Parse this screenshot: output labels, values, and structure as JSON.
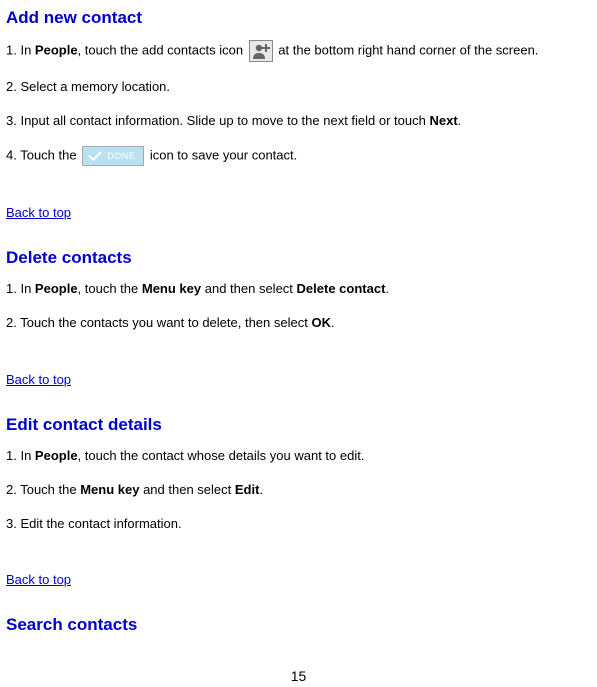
{
  "sections": {
    "add": {
      "title": "Add new contact",
      "step1_a": "1. In ",
      "step1_b": "People",
      "step1_c": ", touch the add contacts icon ",
      "step1_d": " at the bottom right hand corner of the screen.",
      "step2": "2. Select a memory location.",
      "step3_a": "3. Input all contact information. Slide up to move to the next field or touch ",
      "step3_b": "Next",
      "step3_c": ".",
      "step4_a": "4. Touch the ",
      "step4_b": " icon to save your contact."
    },
    "delete": {
      "title": "Delete contacts",
      "step1_a": "1. In ",
      "step1_b": "People",
      "step1_c": ", touch the ",
      "step1_d": "Menu key",
      "step1_e": " and then select ",
      "step1_f": "Delete contact",
      "step1_g": ".",
      "step2_a": "2. Touch the contacts you want to delete, then select ",
      "step2_b": "OK",
      "step2_c": "."
    },
    "edit": {
      "title": "Edit contact details",
      "step1_a": "1. In ",
      "step1_b": "People",
      "step1_c": ", touch the contact whose details you want to edit.",
      "step2_a": "2. Touch the ",
      "step2_b": "Menu key",
      "step2_c": " and then select ",
      "step2_d": "Edit",
      "step2_e": ".",
      "step3": "3. Edit the contact information."
    },
    "search": {
      "title": "Search contacts"
    }
  },
  "back_to_top": "Back to top",
  "page_number": "15"
}
